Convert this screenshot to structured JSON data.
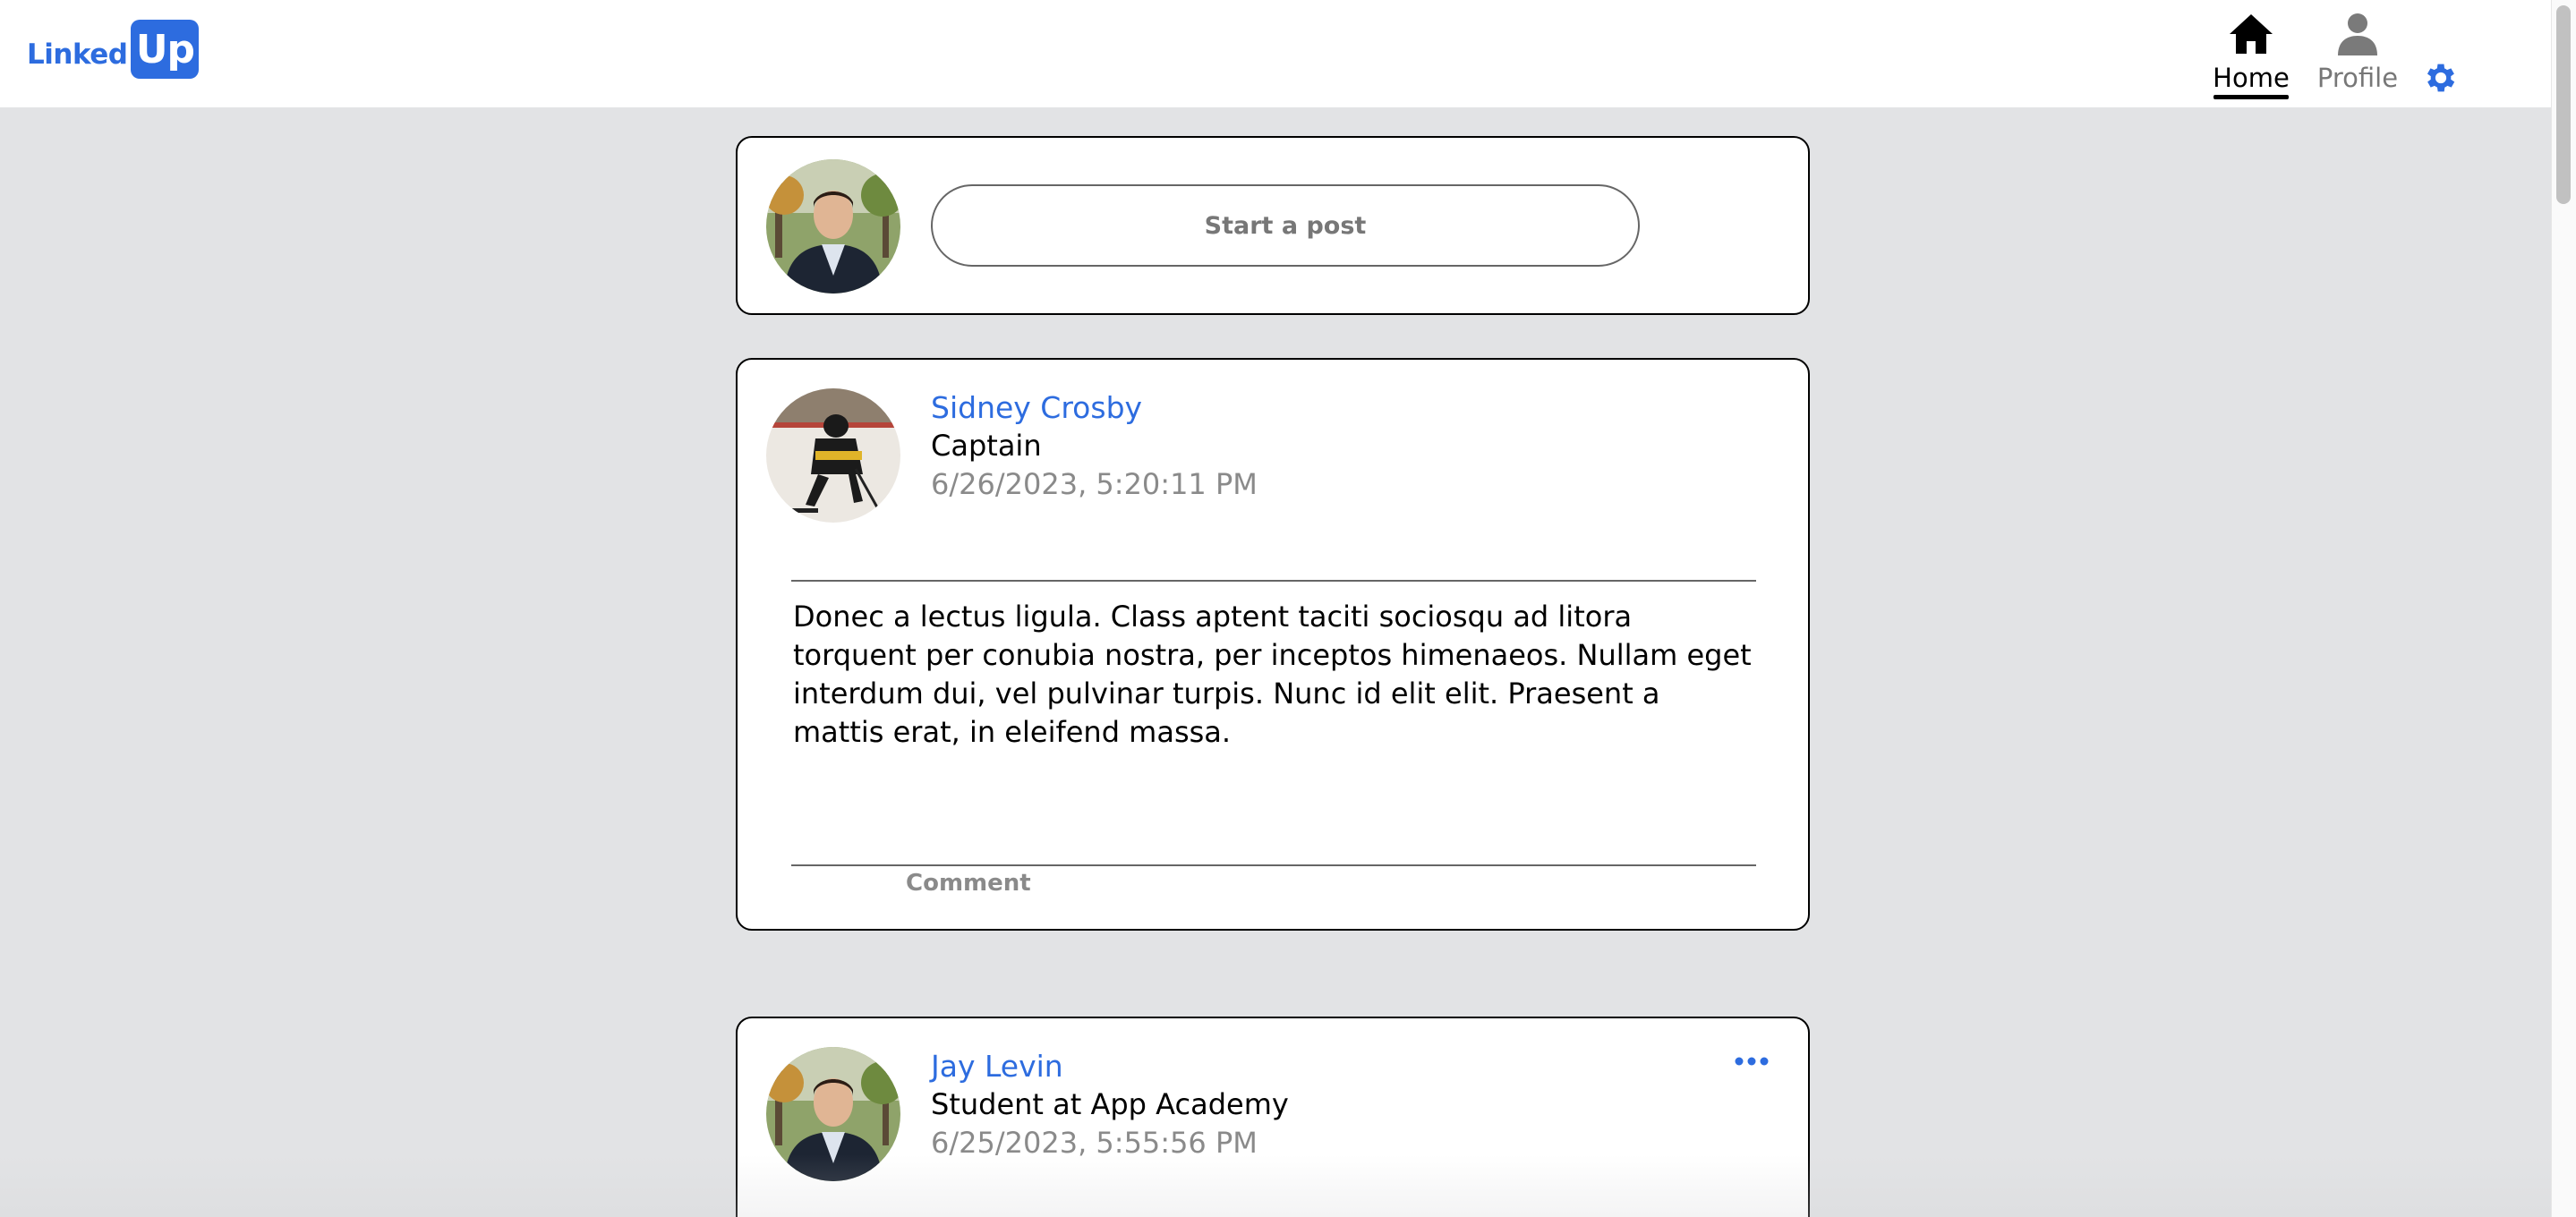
{
  "brand": {
    "logo_text": "Linked",
    "logo_box": "Up",
    "accent_color": "#2d6cdf"
  },
  "nav": {
    "home_label": "Home",
    "profile_label": "Profile",
    "home_icon": "house-icon",
    "profile_icon": "person-icon",
    "settings_icon": "gear-icon"
  },
  "composer": {
    "placeholder": "Start a post"
  },
  "posts": [
    {
      "author": "Sidney Crosby",
      "title": "Captain",
      "timestamp": "6/26/2023, 5:20:11 PM",
      "body": "Donec a lectus ligula. Class aptent taciti sociosqu ad litora torquent per conubia nostra, per inceptos himenaeos. Nullam eget interdum dui, vel pulvinar turpis. Nunc id elit elit. Praesent a mattis erat, in eleifend massa.",
      "comment_label": "Comment"
    },
    {
      "author": "Jay Levin",
      "title": "Student at App Academy",
      "timestamp": "6/25/2023, 5:55:56 PM",
      "more_icon": "ellipsis-icon"
    }
  ]
}
